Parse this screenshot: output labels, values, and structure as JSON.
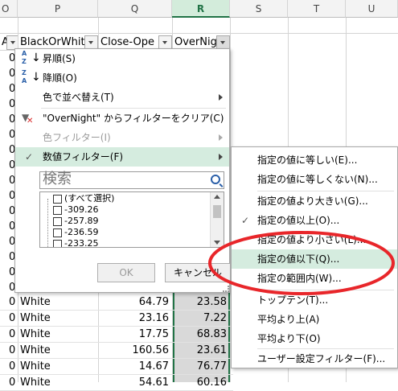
{
  "columns": {
    "partial_left": "O",
    "p": "P",
    "q": "Q",
    "r": "R",
    "s": "S",
    "t": "T",
    "u": "U"
  },
  "filter_row": {
    "o_tail": "Al",
    "p": "BlackOrWhite",
    "q": "Close-Ope",
    "r": "OverNigh"
  },
  "rows": [
    {
      "o": "0",
      "p": "White",
      "q": "64.79",
      "r": "23.58"
    },
    {
      "o": "0",
      "p": "White",
      "q": "23.16",
      "r": "7.22"
    },
    {
      "o": "0",
      "p": "White",
      "q": "17.75",
      "r": "68.83"
    },
    {
      "o": "0",
      "p": "White",
      "q": "160.56",
      "r": "23.61"
    },
    {
      "o": "0",
      "p": "White",
      "q": "14.67",
      "r": "76.77"
    },
    {
      "o": "0",
      "p": "White",
      "q": "54.61",
      "r": "60.16"
    }
  ],
  "left_zeros": [
    "0",
    "0",
    "0",
    "0",
    "0",
    "0",
    "0",
    "0",
    "0",
    "0",
    "0",
    "0",
    "0",
    "0",
    "0",
    "0"
  ],
  "menu": {
    "sort_asc": "昇順(S)",
    "sort_desc": "降順(O)",
    "sort_color": "色で並べ替え(T)",
    "clear_filter": "\"OverNight\" からフィルターをクリア(C)",
    "color_filter": "色フィルター(I)",
    "number_filter": "数値フィルター(F)",
    "search_placeholder": "検索",
    "list": [
      "(すべて選択)",
      "-309.26",
      "-257.89",
      "-236.59",
      "-233.25"
    ],
    "ok": "OK",
    "cancel": "キャンセル"
  },
  "submenu": {
    "items": [
      "指定の値に等しい(E)...",
      "指定の値に等しくない(N)...",
      "指定の値より大きい(G)...",
      "指定の値以上(O)...",
      "指定の値より小さい(L)...",
      "指定の値以下(Q)...",
      "指定の範囲内(W)...",
      "トップテン(T)...",
      "平均より上(A)",
      "平均より下(O)",
      "ユーザー設定フィルター(F)..."
    ]
  },
  "icons": {
    "sort_asc": "sort-ascending-icon",
    "sort_desc": "sort-descending-icon",
    "clear_filter": "clear-filter-icon",
    "check": "checkmark-icon",
    "search": "magnifier-icon"
  },
  "colors": {
    "accent": "#217346",
    "highlight": "#d5ecdf",
    "annotation": "#e8262a"
  }
}
